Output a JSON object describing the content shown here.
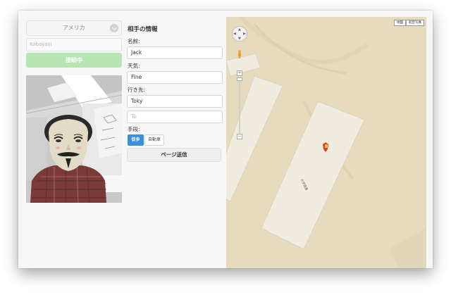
{
  "left": {
    "country_select": {
      "value": "アメリカ"
    },
    "name_input": {
      "placeholder": "Kobayasi"
    },
    "connect_button": {
      "label": "接続中",
      "color": "#b7e6b3"
    },
    "camera_feed": {
      "icon": "video-feed"
    }
  },
  "form": {
    "title": "相手の情報",
    "name_label": "名前:",
    "name_value": "Jack",
    "weather_label": "天気:",
    "weather_value": "Fine",
    "destination_label": "行き先:",
    "destination_value": "Toky",
    "to_placeholder": "To",
    "transport_label": "手段:",
    "transport_options": [
      "徒歩",
      "自動車"
    ],
    "transport_selected": "徒歩",
    "send_button": "ページ送信",
    "accent": "#3a8fd8"
  },
  "map": {
    "map_types": [
      "地図",
      "航空写真"
    ],
    "building_label": "大学図書",
    "zoom_plus": "+",
    "zoom_minus": "−",
    "colors": {
      "background": "#e6dbbd",
      "building": "#f1ece0"
    }
  }
}
